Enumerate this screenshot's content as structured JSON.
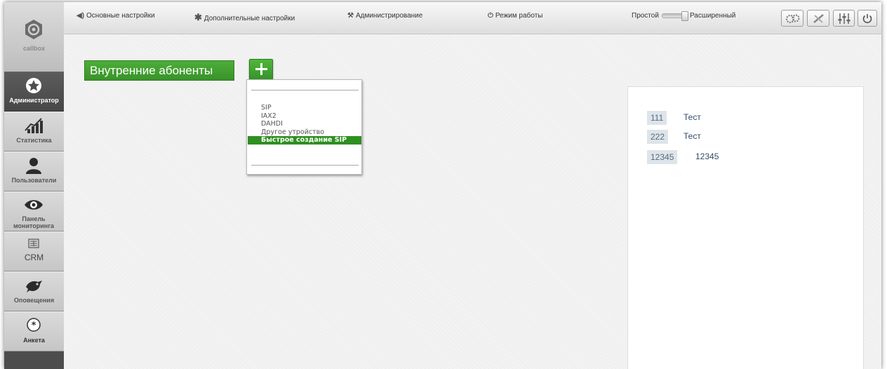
{
  "sidebar": {
    "logo_caption": "callbox",
    "items": [
      {
        "label": "Администратор",
        "icon": "star-icon",
        "active": true
      },
      {
        "label": "Статистика",
        "icon": "chart-icon"
      },
      {
        "label": "Пользователи",
        "icon": "user-icon"
      },
      {
        "label": "Панель мониторинга",
        "icon": "eye-icon"
      },
      {
        "label": "CRM",
        "icon": "crm-icon"
      },
      {
        "label": "Оповещения",
        "icon": "bird-icon"
      },
      {
        "label": "Анкета",
        "icon": "questionnaire-icon"
      }
    ]
  },
  "topbar": {
    "menu": [
      {
        "label": "Основные настройки",
        "icon": "speaker-icon"
      },
      {
        "label": "Дополнительные настройки",
        "icon": "asterisk-icon"
      },
      {
        "label": "Администрирование",
        "icon": "wrench-icon"
      },
      {
        "label": "Режим работы",
        "icon": "power-icon"
      }
    ],
    "mode_left": "Простой",
    "mode_right": "Расширенный",
    "buttons": [
      "cog-group-icon",
      "tools-icon",
      "sliders-icon",
      "power-icon"
    ]
  },
  "main": {
    "section_title": "Внутренние абоненты",
    "add_menu": {
      "items": [
        "SIP",
        "IAX2",
        "DAHDI",
        "Другое утройство",
        "Быстрое создание SIP"
      ],
      "selected": "Быстрое создание SIP"
    },
    "subscribers": [
      {
        "number": "111",
        "name": "Тест"
      },
      {
        "number": "222",
        "name": "Тест"
      },
      {
        "number": "12345",
        "name": "12345"
      }
    ]
  },
  "colors": {
    "accent_green": "#3ea12d",
    "sidebar_dark": "#4d4d4d",
    "number_bg": "#dde4ea"
  }
}
